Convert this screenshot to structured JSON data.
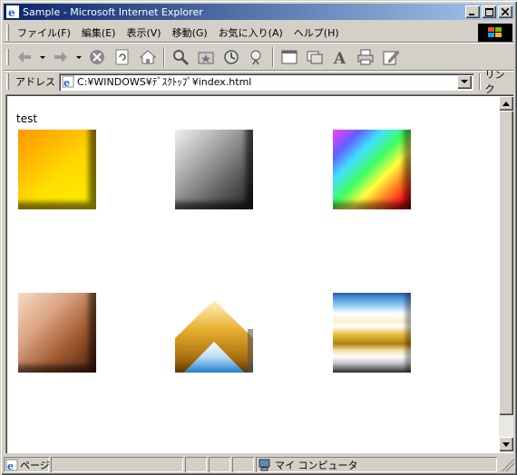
{
  "window": {
    "title": "Sample - Microsoft Internet Explorer",
    "minimize": "_",
    "maximize": "□",
    "close": "×"
  },
  "menu": {
    "items": [
      "ファイル(F)",
      "編集(E)",
      "表示(V)",
      "移動(G)",
      "お気に入り(A)",
      "ヘルプ(H)"
    ]
  },
  "address": {
    "label": "アドレス",
    "url": "C:¥WINDOWS¥ﾃﾞｽｸﾄｯﾌﾟ¥index.html",
    "links_label": "リンク"
  },
  "page": {
    "text": "test"
  },
  "status": {
    "page_text": "ページ",
    "zone_text": "マイ コンピュータ"
  },
  "colors": {
    "titlebar_start": "#0a246a",
    "titlebar_end": "#a6caf0",
    "chrome": "#d4d0c8"
  }
}
